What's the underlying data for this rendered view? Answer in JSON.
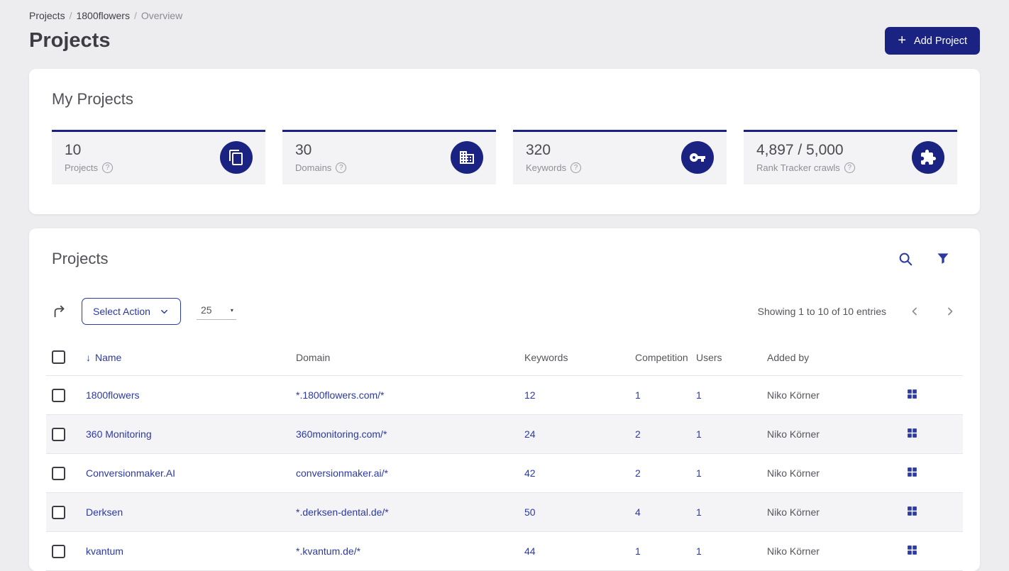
{
  "breadcrumb": {
    "separator": "/",
    "items": [
      {
        "label": "Projects"
      },
      {
        "label": "1800flowers"
      },
      {
        "label": "Overview"
      }
    ]
  },
  "header": {
    "title": "Projects",
    "add_project_label": "Add Project",
    "add_icon": "+"
  },
  "my_projects": {
    "title": "My Projects",
    "help_glyph": "?",
    "cards": [
      {
        "value": "10",
        "label": "Projects",
        "icon": "projects-copy-icon"
      },
      {
        "value": "30",
        "label": "Domains",
        "icon": "building-icon"
      },
      {
        "value": "320",
        "label": "Keywords",
        "icon": "key-icon"
      },
      {
        "value": "4,897 / 5,000",
        "label": "Rank Tracker crawls",
        "icon": "puzzle-icon"
      }
    ]
  },
  "projects_table": {
    "title": "Projects",
    "sort_arrow": "↓",
    "toolbar": {
      "select_action_label": "Select Action",
      "page_size": "25",
      "caret": "▾",
      "showing_text": "Showing 1 to 10 of 10 entries"
    },
    "columns": {
      "name": "Name",
      "domain": "Domain",
      "keywords": "Keywords",
      "competition": "Competition",
      "users": "Users",
      "added_by": "Added by"
    },
    "rows": [
      {
        "name": "1800flowers",
        "domain": "*.1800flowers.com/*",
        "keywords": "12",
        "competition": "1",
        "users": "1",
        "added_by": "Niko Körner"
      },
      {
        "name": "360 Monitoring",
        "domain": "360monitoring.com/*",
        "keywords": "24",
        "competition": "2",
        "users": "1",
        "added_by": "Niko Körner"
      },
      {
        "name": "Conversionmaker.AI",
        "domain": "conversionmaker.ai/*",
        "keywords": "42",
        "competition": "2",
        "users": "1",
        "added_by": "Niko Körner"
      },
      {
        "name": "Derksen",
        "domain": "*.derksen-dental.de/*",
        "keywords": "50",
        "competition": "4",
        "users": "1",
        "added_by": "Niko Körner"
      },
      {
        "name": "kvantum",
        "domain": "*.kvantum.de/*",
        "keywords": "44",
        "competition": "1",
        "users": "1",
        "added_by": "Niko Körner"
      }
    ]
  },
  "colors": {
    "accent": "#1b2382",
    "link": "#2c39a3",
    "page_bg": "#ededef"
  }
}
